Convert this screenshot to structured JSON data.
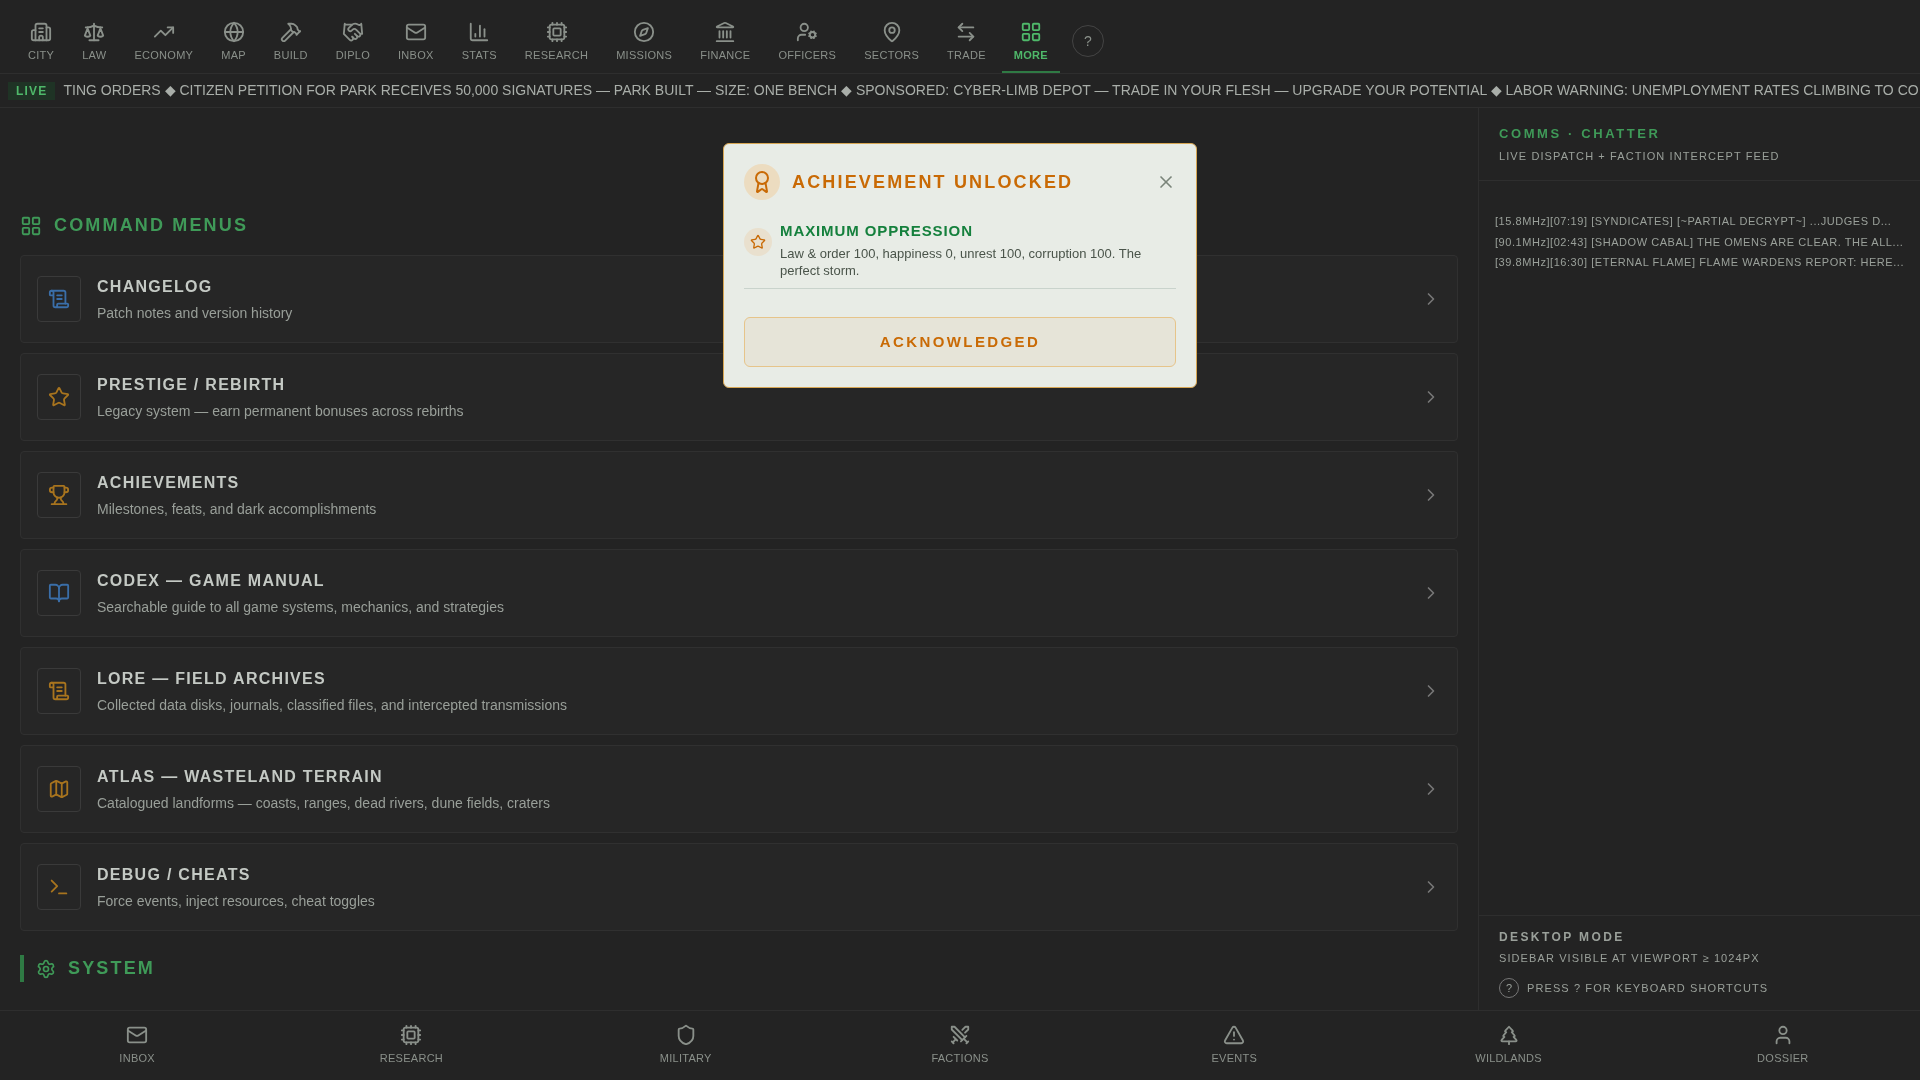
{
  "top_nav": {
    "items": [
      {
        "label": "CITY",
        "selected": false
      },
      {
        "label": "LAW",
        "selected": false
      },
      {
        "label": "ECONOMY",
        "selected": false
      },
      {
        "label": "MAP",
        "selected": false
      },
      {
        "label": "BUILD",
        "selected": false
      },
      {
        "label": "DIPLO",
        "selected": false
      },
      {
        "label": "INBOX",
        "selected": false
      },
      {
        "label": "STATS",
        "selected": false
      },
      {
        "label": "RESEARCH",
        "selected": false
      },
      {
        "label": "MISSIONS",
        "selected": false
      },
      {
        "label": "FINANCE",
        "selected": false
      },
      {
        "label": "OFFICERS",
        "selected": false
      },
      {
        "label": "SECTORS",
        "selected": false
      },
      {
        "label": "TRADE",
        "selected": false
      },
      {
        "label": "MORE",
        "selected": true
      }
    ],
    "help_button": "?"
  },
  "ticker": {
    "badge": "LIVE",
    "text": "TING ORDERS ◆ CITIZEN PETITION FOR PARK RECEIVES 50,000 SIGNATURES — PARK BUILT — SIZE: ONE BENCH ◆ SPONSORED: CYBER-LIMB DEPOT — TRADE IN YOUR FLESH — UPGRADE YOUR POTENTIAL ◆ LABOR WARNING: UNEMPLOYMENT RATES CLIMBING TO CO"
  },
  "command_menus": {
    "title": "COMMAND MENUS",
    "items": [
      {
        "title": "CHANGELOG",
        "description": "Patch notes and version history"
      },
      {
        "title": "PRESTIGE / REBIRTH",
        "description": "Legacy system — earn permanent bonuses across rebirths"
      },
      {
        "title": "ACHIEVEMENTS",
        "description": "Milestones, feats, and dark accomplishments"
      },
      {
        "title": "CODEX — GAME MANUAL",
        "description": "Searchable guide to all game systems, mechanics, and strategies"
      },
      {
        "title": "LORE — FIELD ARCHIVES",
        "description": "Collected data disks, journals, classified files, and intercepted transmissions"
      },
      {
        "title": "ATLAS — WASTELAND TERRAIN",
        "description": "Catalogued landforms — coasts, ranges, dead rivers, dune fields, craters"
      },
      {
        "title": "DEBUG / CHEATS",
        "description": "Force events, inject resources, cheat toggles"
      }
    ]
  },
  "system_section": {
    "title": "SYSTEM"
  },
  "sidebar": {
    "comms": {
      "title": "COMMS · CHATTER",
      "subtitle": "LIVE DISPATCH + FACTION INTERCEPT FEED",
      "lines": [
        "[15.8MHz][07:19] [SYNDICATES] [~PARTIAL DECRYPT~] ...JUDGES D...",
        "[90.1MHz][02:43] [SHADOW CABAL] THE OMENS ARE CLEAR. THE ALL...",
        "[39.8MHz][16:30] [ETERNAL FLAME] FLAME WARDENS REPORT: HERE..."
      ]
    },
    "desktop": {
      "title": "DESKTOP MODE",
      "subtitle": "SIDEBAR VISIBLE AT VIEWPORT ≥ 1024PX",
      "hint_key": "?",
      "hint": "PRESS ? FOR KEYBOARD SHORTCUTS"
    }
  },
  "bottom_nav": {
    "items": [
      {
        "label": "INBOX"
      },
      {
        "label": "RESEARCH"
      },
      {
        "label": "MILITARY"
      },
      {
        "label": "FACTIONS"
      },
      {
        "label": "EVENTS"
      },
      {
        "label": "WILDLANDS"
      },
      {
        "label": "DOSSIER"
      }
    ]
  },
  "modal": {
    "title": "ACHIEVEMENT UNLOCKED",
    "achievement": {
      "name": "MAXIMUM OPPRESSION",
      "description": "Law & order 100, happiness 0, unrest 100, corruption 100. The perfect storm."
    },
    "button": "ACKNOWLEDGED"
  }
}
